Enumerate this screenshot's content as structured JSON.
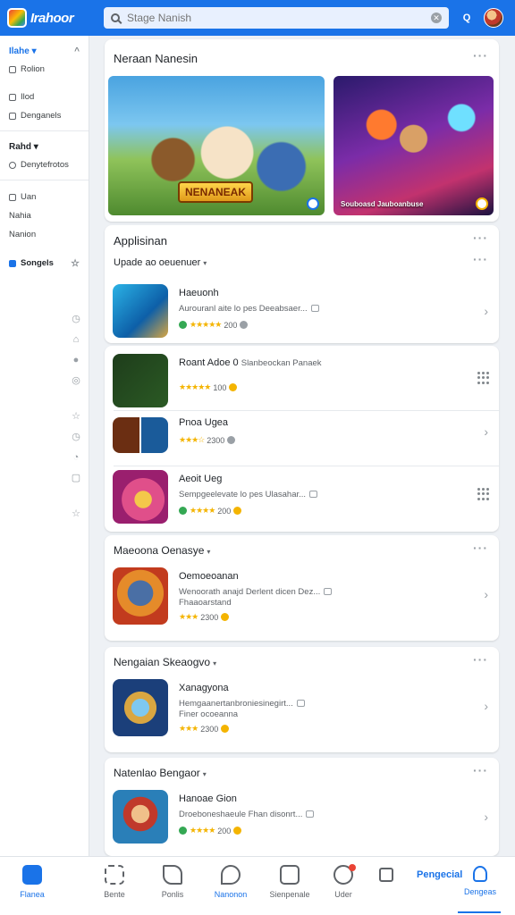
{
  "header": {
    "logo_text": "Irahoor",
    "search_placeholder": "Stage Nanish",
    "q_label": "Q"
  },
  "sidebar": {
    "group1_title": "Ilahe",
    "group1_items": [
      "Rolion",
      "Ilod",
      "Denganels"
    ],
    "group2_title": "Rahd",
    "group2_items": [
      "Denytefrotos"
    ],
    "group3_items": [
      "Uan",
      "Nahia",
      "Nanion"
    ],
    "active_item": "Songels"
  },
  "featured": {
    "title": "Neraan Nanesin",
    "banner1_logo": "NENANEAK",
    "banner2_caption": "Souboasd Jauboanbuse"
  },
  "applications": {
    "title": "Applisinan",
    "subtitle": "Upade ao oeuenuer",
    "apps": [
      {
        "name": "Haeuonh",
        "desc": "Aurouranl aite lo pes Deeabsaer...",
        "meta": "200"
      },
      {
        "name": "Roant Adoe 0",
        "desc": "Slanbeockan Panaek",
        "meta": "100"
      },
      {
        "name": "Pnoa Ugea",
        "desc": "",
        "meta": "2300"
      },
      {
        "name": "Aeoit Ueg",
        "desc": "Sempgeelevate lo pes Ulasahar...",
        "meta": "200"
      }
    ]
  },
  "section2": {
    "title": "Maeoona Oenasye",
    "app": {
      "name": "Oemoeoanan",
      "desc": "Wenoorath anajd Derlent dicen Dez...",
      "desc2": "Fhaaoarstand",
      "meta": "2300"
    }
  },
  "section3": {
    "title": "Nengaian Skeaogvo",
    "app": {
      "name": "Xanagyona",
      "desc": "Hemgaanertanbroniesinegirt...",
      "desc2": "Finer ocoeanna",
      "meta": "2300"
    }
  },
  "section4": {
    "title": "Natenlao Bengaor",
    "app": {
      "name": "Hanoae Gion",
      "desc": "Droeboneshaeule Fhan disonrt...",
      "meta": "200"
    }
  },
  "bottom_nav": {
    "items": [
      "Flanea",
      "Bente",
      "Ponlis",
      "Nanonon",
      "Sienpenale",
      "Uder"
    ],
    "text_button": "Pengecial",
    "profile_label": "Dengeas"
  },
  "colors": {
    "accent": "#1a73e8",
    "star": "#f4b400"
  }
}
